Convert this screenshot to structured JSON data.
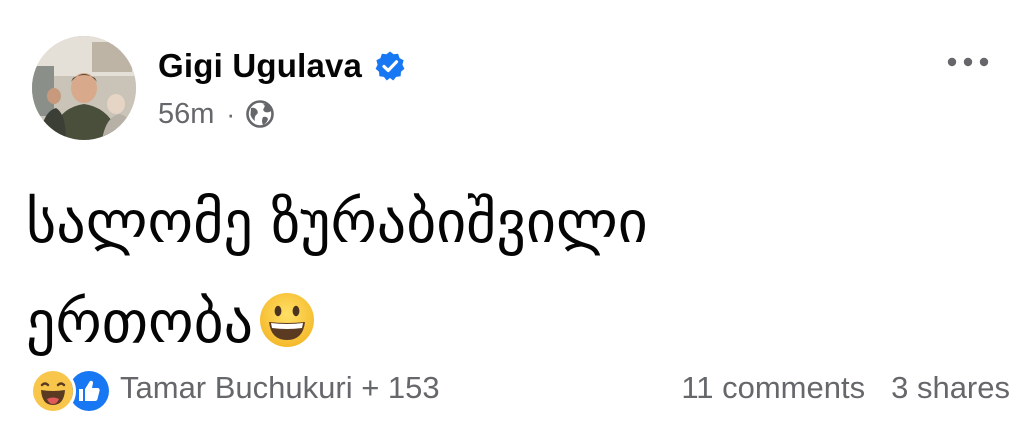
{
  "post": {
    "author": {
      "name": "Gigi Ugulava",
      "verified": true,
      "avatar_icon": "profile-photo"
    },
    "meta": {
      "time": "56m",
      "separator": "·",
      "audience_icon": "globe-icon"
    },
    "more_icon": "more-horizontal-icon",
    "text_lines": [
      "სალომე ზურაბიშვილი",
      "ერთობა"
    ],
    "text_emoji": "grinning-face-emoji",
    "footer": {
      "reaction_icons": [
        "haha-reaction-icon",
        "like-reaction-icon"
      ],
      "reactors": "Tamar Buchukuri + 153",
      "comments": "11 comments",
      "shares": "3 shares"
    }
  },
  "colors": {
    "text": "#050505",
    "secondary_text": "#65676b",
    "verified_blue": "#1877f2",
    "like_blue": "#1877f2",
    "haha_yellow": "#f7c64a"
  }
}
